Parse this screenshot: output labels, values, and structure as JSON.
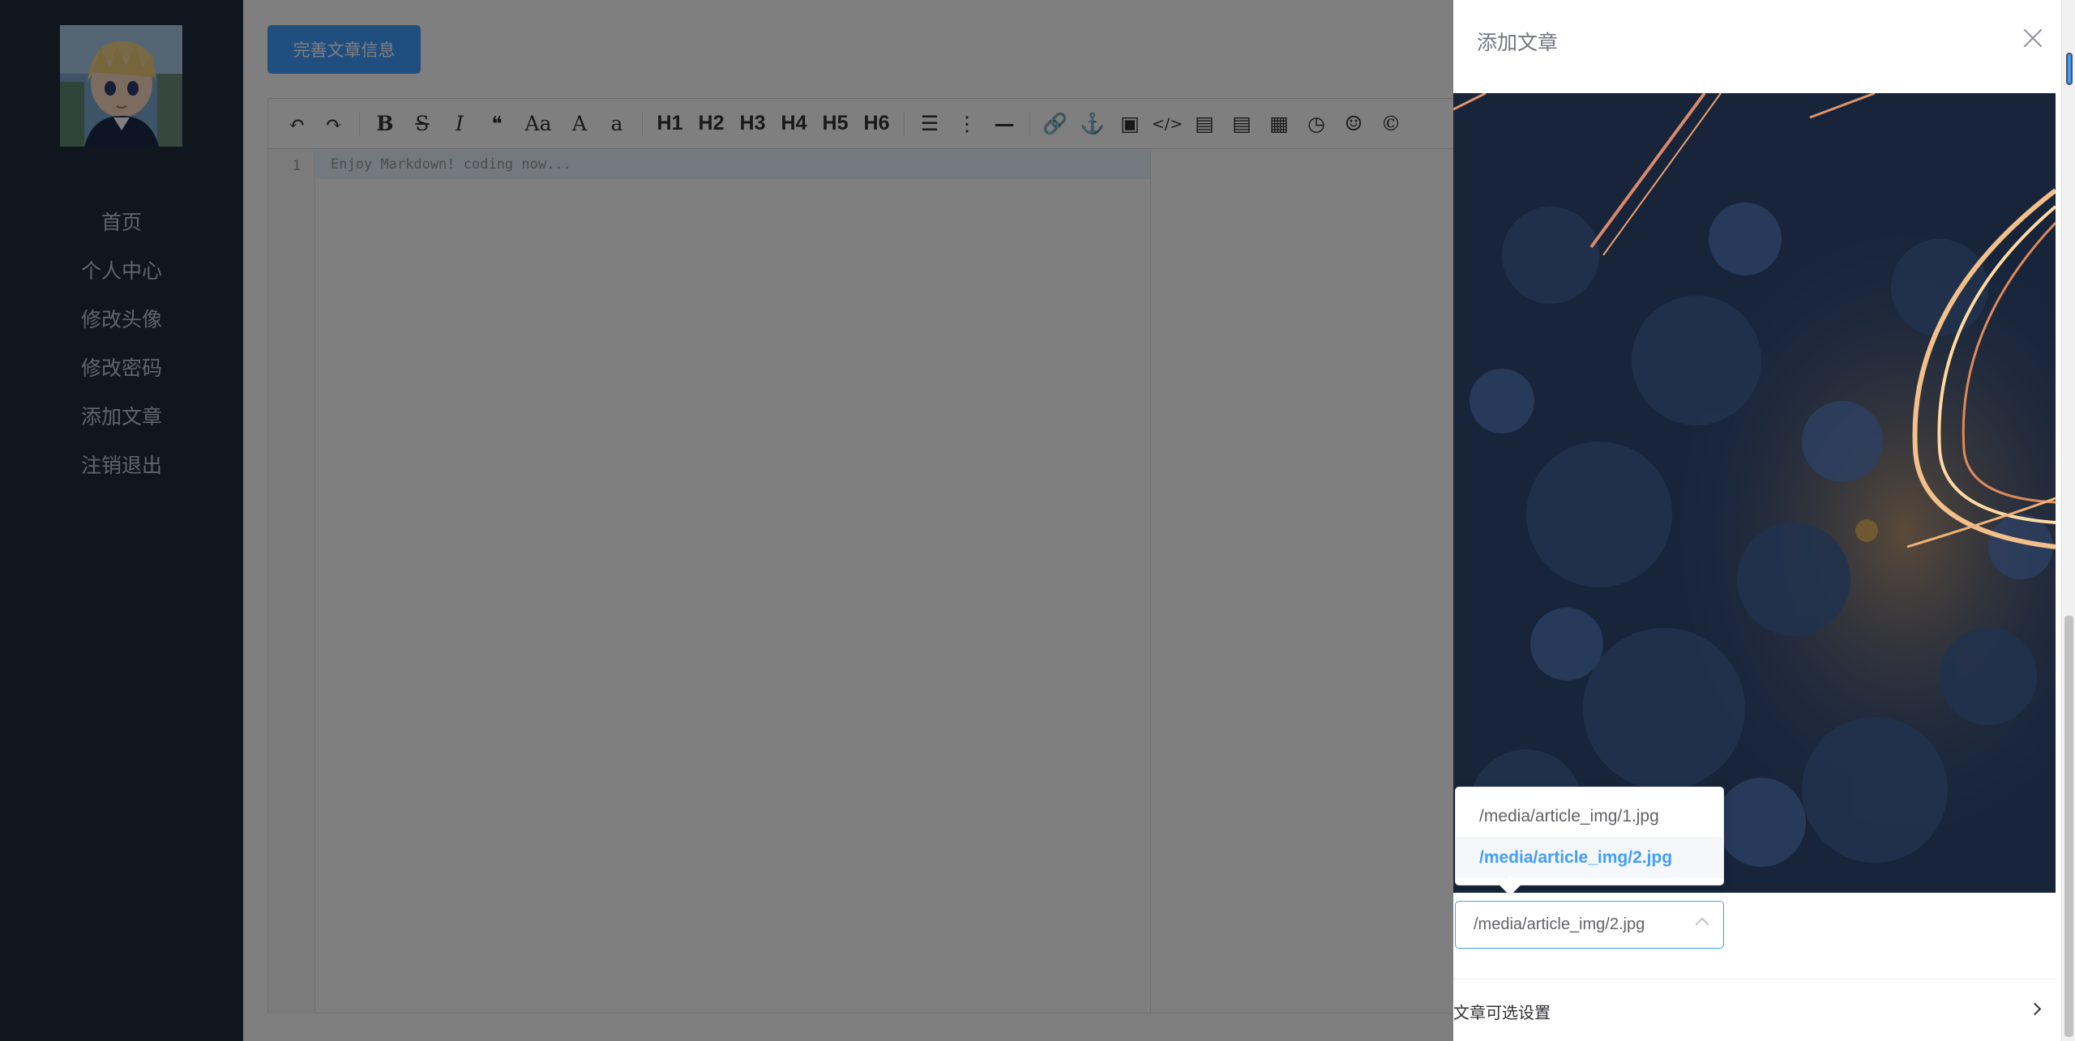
{
  "sidebar": {
    "avatar_alt": "anime avatar",
    "items": [
      {
        "label": "首页"
      },
      {
        "label": "个人中心"
      },
      {
        "label": "修改头像"
      },
      {
        "label": "修改密码"
      },
      {
        "label": "添加文章"
      },
      {
        "label": "注销退出"
      }
    ]
  },
  "main": {
    "complete_button": "完善文章信息",
    "editor": {
      "line_number": "1",
      "placeholder": "Enjoy Markdown! coding now...",
      "toolbar": {
        "undo": "↶",
        "redo": "↷",
        "bold": "B",
        "strike": "S",
        "italic": "I",
        "quote": "❝",
        "uppercase": "Aa",
        "uppercase_a": "A",
        "lowercase": "a",
        "h1": "H1",
        "h2": "H2",
        "h3": "H3",
        "h4": "H4",
        "h5": "H5",
        "h6": "H6",
        "list_ul": "☰",
        "list_ol": "⋮",
        "hr": "—",
        "link": "🔗",
        "anchor": "⚓",
        "image": "▣",
        "code": "</>",
        "code_block": "▤",
        "preformatted": "▤",
        "table": "▦",
        "datetime": "◷",
        "emoji": "☺",
        "copyright": "©"
      }
    }
  },
  "drawer": {
    "title": "添加文章",
    "select": {
      "value": "/media/article_img/2.jpg",
      "options": [
        "/media/article_img/1.jpg",
        "/media/article_img/2.jpg"
      ]
    },
    "collapse_title": "文章可选设置"
  },
  "colors": {
    "accent": "#409eff",
    "sidebar_bg": "#1f2d3d",
    "mask": "rgba(0,0,0,0.5)"
  }
}
